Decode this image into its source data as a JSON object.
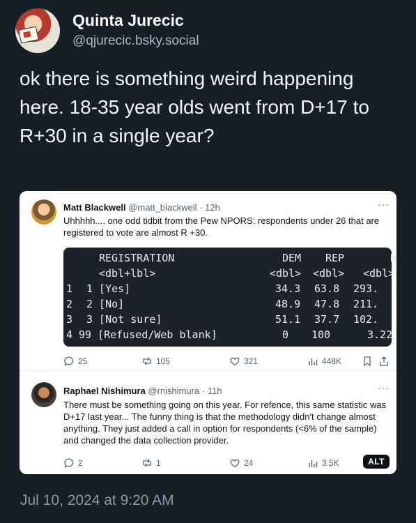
{
  "author": {
    "display_name": "Quinta Jurecic",
    "handle": "@qjurecic.bsky.social"
  },
  "post": {
    "text": "ok there is something weird happening here. 18-35 year olds went from D+17 to R+30 in a single year?",
    "timestamp": "Jul 10, 2024 at 9:20 AM"
  },
  "embed": {
    "alt_badge": "ALT",
    "tweets": [
      {
        "name": "Matt Blackwell",
        "handle_time": "@matt_blackwell · 12h",
        "more": "···",
        "text": "Uhhhhh.... one odd tidbit from the Pew NPORS: respondents under 26 that are registered to vote are almost R +30.",
        "table": {
          "columns": [
            {
              "name": "REGISTRATION",
              "type": "<dbl+lbl>"
            },
            {
              "name": "DEM",
              "type": "<dbl>"
            },
            {
              "name": "REP",
              "type": "<dbl>"
            },
            {
              "name": "N",
              "type": "<dbl>"
            }
          ],
          "rows": [
            {
              "idx": "1",
              "registration": "1 [Yes]",
              "dem": "34.3",
              "rep": "63.8",
              "n": "293."
            },
            {
              "idx": "2",
              "registration": "2 [No]",
              "dem": "48.9",
              "rep": "47.8",
              "n": "211."
            },
            {
              "idx": "3",
              "registration": "3 [Not sure]",
              "dem": "51.1",
              "rep": "37.7",
              "n": "102."
            },
            {
              "idx": "4",
              "registration": "99 [Refused/Web blank]",
              "dem": "0",
              "rep": "100",
              "n": "3.22"
            }
          ]
        },
        "actions": {
          "replies": "25",
          "reposts": "105",
          "likes": "321",
          "views": "448K"
        }
      },
      {
        "name": "Raphael Nishimura",
        "handle_time": "@rnishimura · 11h",
        "more": "···",
        "text": "There must be something going on this year. For refence, this same statistic was D+17 last year... The funny thing is that the methodology didn't change almost anything. They just added a call in option for respondents (<6% of the sample) and changed the data collection provider.",
        "actions": {
          "replies": "2",
          "reposts": "1",
          "likes": "24",
          "views": "3.5K"
        }
      }
    ]
  }
}
